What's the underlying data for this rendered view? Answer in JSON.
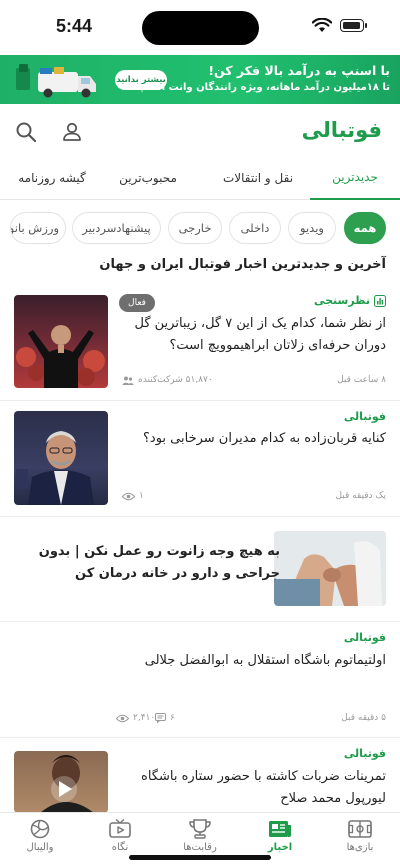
{
  "status_bar": {
    "time": "5:44"
  },
  "ad": {
    "title": "با اسنپ به درآمد بالا فکر کن!",
    "subtitle": "تا ۱۸میلیون درآمد ماهانه، ویژه رانندگان وانت اسنپ!",
    "button_label": "بیشتر بدانید"
  },
  "header": {
    "logo": "فوتبالی"
  },
  "tabs": [
    {
      "label": "جدیدترین"
    },
    {
      "label": "نقل و انتقالات"
    },
    {
      "label": "محبوب‌ترین"
    },
    {
      "label": "گیشه روزنامه"
    }
  ],
  "chips": [
    {
      "label": "همه"
    },
    {
      "label": "ویدیو"
    },
    {
      "label": "داخلی"
    },
    {
      "label": "خارجی"
    },
    {
      "label": "پیشنهادسردبیر"
    },
    {
      "label": "ورزش بانوان"
    }
  ],
  "section_heading": "آخرین و جدیدترین اخبار فوتبال ایران و جهان",
  "articles": [
    {
      "category": "نظرسنجی",
      "title": "از نظر شما، کدام یک از این ۷ گل، زیباترین گل دوران حرفه‌ای زلاتان ابراهیموویچ است؟",
      "badge": "فعال",
      "time": "۸ ساعت قبل",
      "participants": "۵۱,۸۷۰ شرکت‌کننده"
    },
    {
      "category": "فوتبالی",
      "title": "کنایه قربان‌زاده به کدام مدیران سرخابی بود؟",
      "time": "یک دقیقه قبل",
      "views": "۱"
    },
    {
      "title": "به هیچ وجه زانوت رو عمل نکن | بدون جراحی و دارو در خانه درمان کن"
    },
    {
      "category": "فوتبالی",
      "title": "اولتیماتوم باشگاه استقلال به ابوالفضل جلالی",
      "time": "۵ دقیقه قبل",
      "comments": "۶",
      "views": "۲,۴۱۰"
    },
    {
      "category": "فوتبالی",
      "title": "تمرینات ضربات کاشته با حضور ستاره باشگاه لیورپول محمد صلاح"
    }
  ],
  "bottom_nav": [
    {
      "label": "بازی‌ها",
      "icon": "soccer-field-icon"
    },
    {
      "label": "اخبار",
      "icon": "newspaper-icon"
    },
    {
      "label": "رقابت‌ها",
      "icon": "trophy-icon"
    },
    {
      "label": "نگاه",
      "icon": "tv-play-icon"
    },
    {
      "label": "والیبال",
      "icon": "volleyball-icon"
    }
  ],
  "colors": {
    "brand_green": "#1e9c4b",
    "ad_green": "#21c06f"
  }
}
